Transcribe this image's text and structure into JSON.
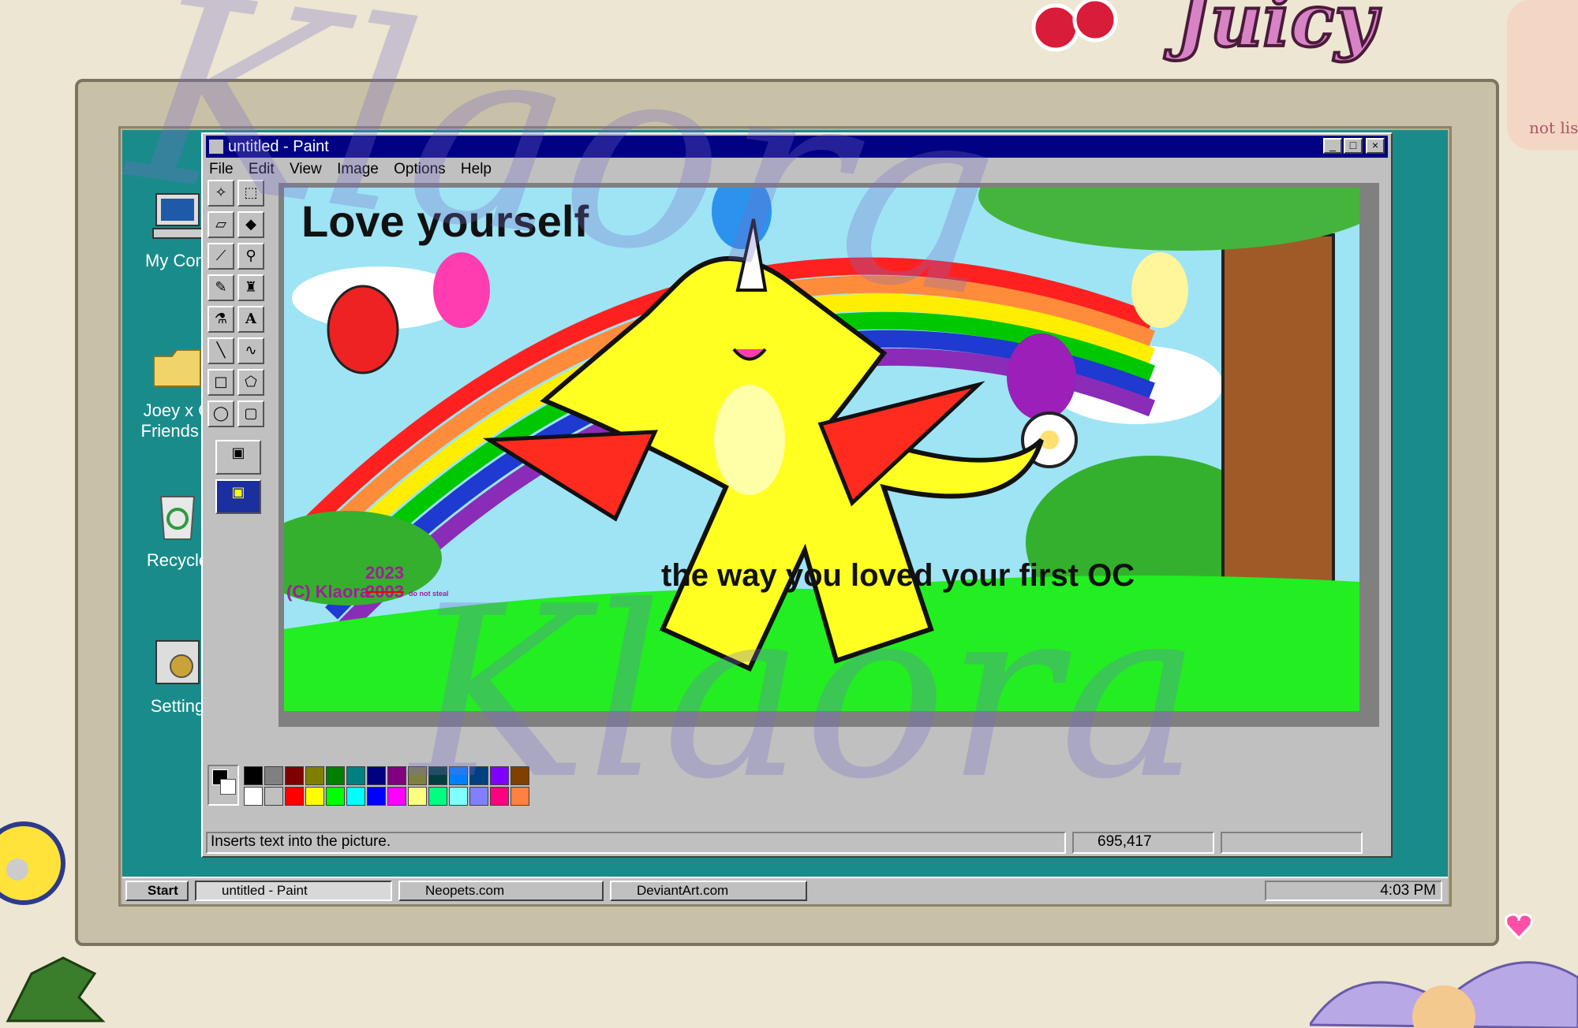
{
  "window": {
    "title": "untitled - Paint",
    "menu": [
      "File",
      "Edit",
      "View",
      "Image",
      "Options",
      "Help"
    ],
    "status_text": "Inserts text into the picture.",
    "coordinates": "695,417"
  },
  "desktop_icons": [
    {
      "label": "My Com",
      "icon": "computer-icon"
    },
    {
      "label": "Joey x G\nFriends F",
      "icon": "folder-icon"
    },
    {
      "label": "Recycle",
      "icon": "recycle-bin-icon"
    },
    {
      "label": "Setting",
      "icon": "settings-icon"
    }
  ],
  "canvas": {
    "headline": "Love yourself",
    "subline": "the way you loved your first OC",
    "copyright": "(C) Klaora",
    "year_new": "2023",
    "year_old": "2003",
    "note": "do not steal"
  },
  "taskbar": {
    "start": "Start",
    "items": [
      "untitled - Paint",
      "Neopets.com",
      "DeviantArt.com"
    ],
    "clock": "4:03 PM"
  },
  "watermark": {
    "line1": "Klaora",
    "line2": "Klaora"
  },
  "sticker_text": {
    "top_word": "Juicy",
    "note": "not liste"
  },
  "palette_colors": [
    "#000000",
    "#808080",
    "#800000",
    "#808000",
    "#008000",
    "#008080",
    "#000080",
    "#800080",
    "#808040",
    "#004040",
    "#0080ff",
    "#004080",
    "#8000ff",
    "#804000",
    "#ffffff",
    "#c0c0c0",
    "#ff0000",
    "#ffff00",
    "#00ff00",
    "#00ffff",
    "#0000ff",
    "#ff00ff",
    "#ffff80",
    "#00ff80",
    "#80ffff",
    "#8080ff",
    "#ff0080",
    "#ff8040"
  ]
}
